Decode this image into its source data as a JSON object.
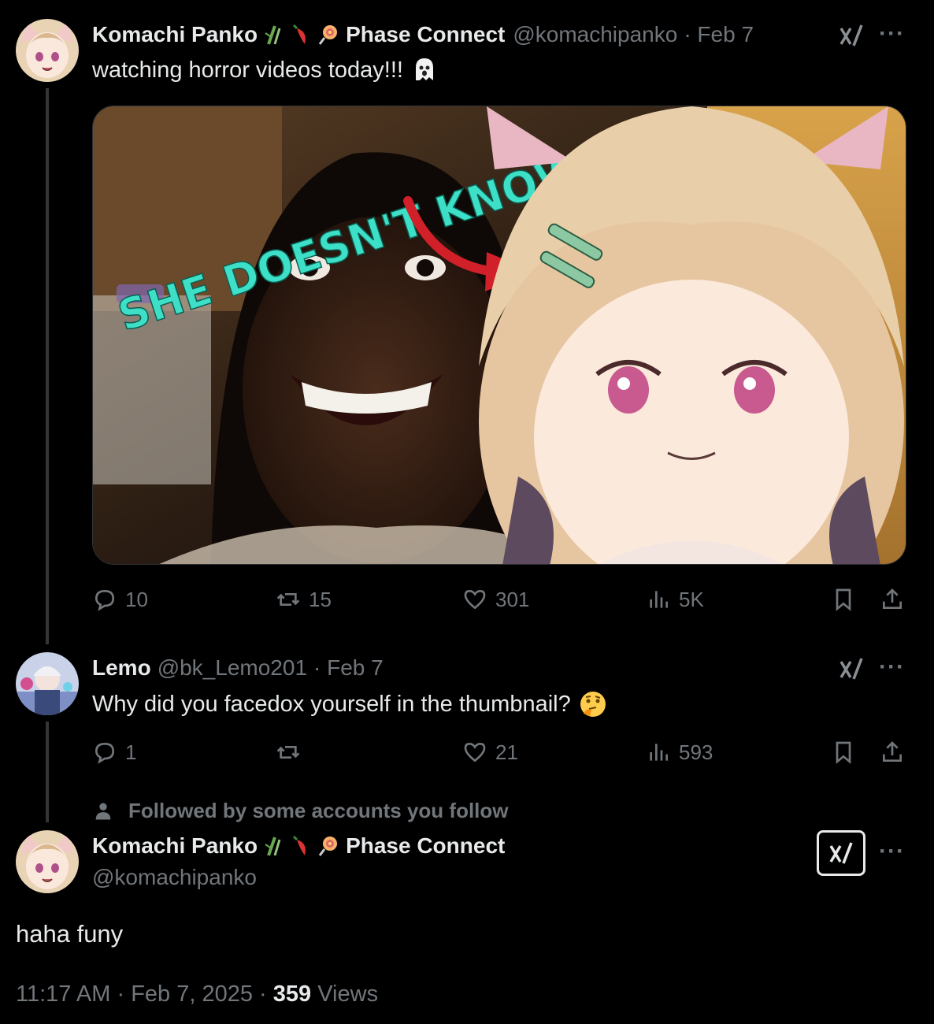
{
  "tweet1": {
    "display_name": "Komachi Panko",
    "affiliation": "Phase Connect",
    "handle": "@komachipanko",
    "date": "· Feb 7",
    "text": "watching horror videos today!!!",
    "text_emoji": "ghost-emoji",
    "media": {
      "overlay_text": "SHE DOESN'T KNOW"
    },
    "stats": {
      "replies": "10",
      "reposts": "15",
      "likes": "301",
      "views": "5K"
    }
  },
  "tweet2": {
    "display_name": "Lemo",
    "handle": "@bk_Lemo201",
    "date": "· Feb 7",
    "text": "Why did you facedox yourself in the thumbnail?",
    "text_emoji": "thinking-face-emoji",
    "stats": {
      "replies": "1",
      "reposts": "",
      "likes": "21",
      "views": "593"
    }
  },
  "followed_by": "Followed by some accounts you follow",
  "main_tweet": {
    "display_name": "Komachi Panko",
    "affiliation": "Phase Connect",
    "handle": "@komachipanko",
    "text": "haha funy",
    "time": "11:17 AM",
    "date": "Feb 7, 2025",
    "views_count": "359",
    "views_label": "Views"
  },
  "colors": {
    "background": "#000000",
    "text": "#e7e9ea",
    "muted": "#71767b",
    "thread_line": "#333639",
    "overlay_text": "#3de0c6"
  }
}
